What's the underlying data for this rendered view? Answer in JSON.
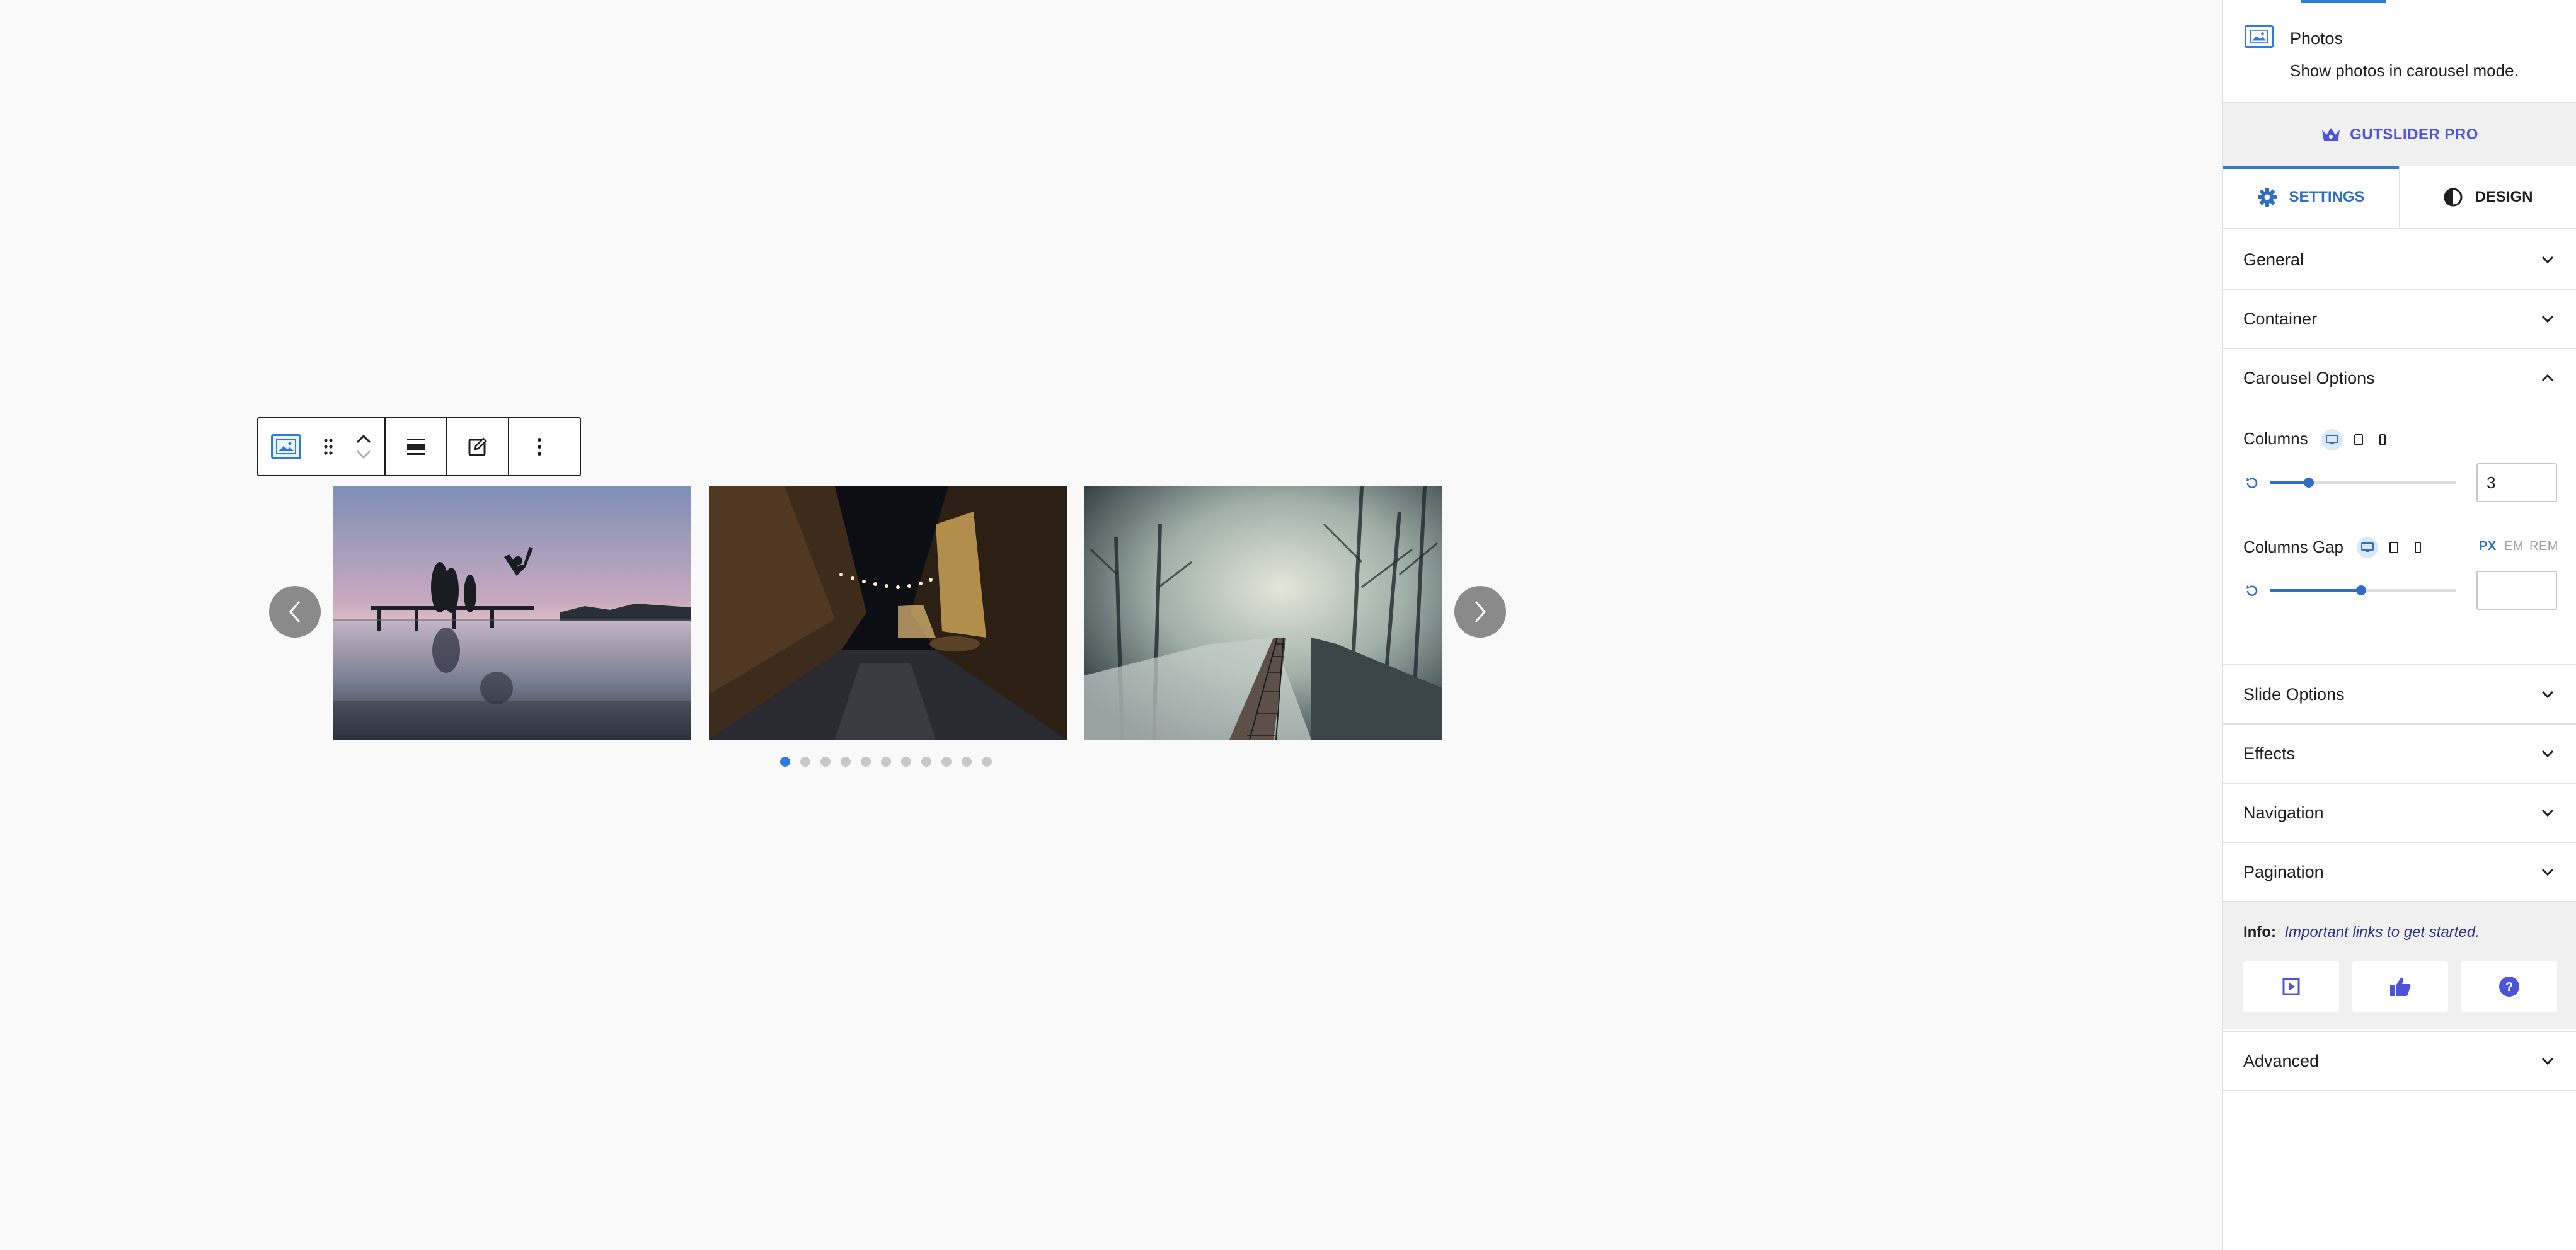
{
  "colors": {
    "accent": "#2f7bd8",
    "pro": "#4d54d8",
    "pagination_active": "#2f7bd8"
  },
  "canvas": {
    "toolbar": {
      "icons": [
        "carousel-block-icon",
        "drag-handle-icon",
        "move-up-icon",
        "move-down-icon",
        "align-wide-icon",
        "edit-icon",
        "more-options-icon"
      ]
    },
    "images": [
      {
        "name": "lake-jump-photo"
      },
      {
        "name": "night-street-photo"
      },
      {
        "name": "foggy-railway-photo"
      }
    ],
    "pagination": {
      "count": 11,
      "active_index": 0
    }
  },
  "sidebar": {
    "block": {
      "title": "Photos",
      "description": "Show photos in carousel mode."
    },
    "pro_banner": {
      "label": "GUTSLIDER PRO"
    },
    "tabs": [
      {
        "label": "SETTINGS",
        "icon": "gear-icon",
        "active": true
      },
      {
        "label": "DESIGN",
        "icon": "half-circle-icon",
        "active": false
      }
    ],
    "panels": {
      "general": "General",
      "container": "Container",
      "carousel_options": "Carousel Options",
      "slide_options": "Slide Options",
      "effects": "Effects",
      "navigation": "Navigation",
      "pagination": "Pagination",
      "advanced": "Advanced"
    },
    "columns": {
      "label": "Columns",
      "value": "3",
      "slider_fraction": 0.21
    },
    "columns_gap": {
      "label": "Columns Gap",
      "value": "",
      "slider_fraction": 0.49,
      "units": [
        "PX",
        "EM",
        "REM"
      ],
      "active_unit": "PX"
    },
    "info": {
      "label": "Info:",
      "text": "Important links to get started."
    },
    "info_buttons": [
      "video-play-icon",
      "thumbs-up-icon",
      "help-question-icon"
    ]
  }
}
